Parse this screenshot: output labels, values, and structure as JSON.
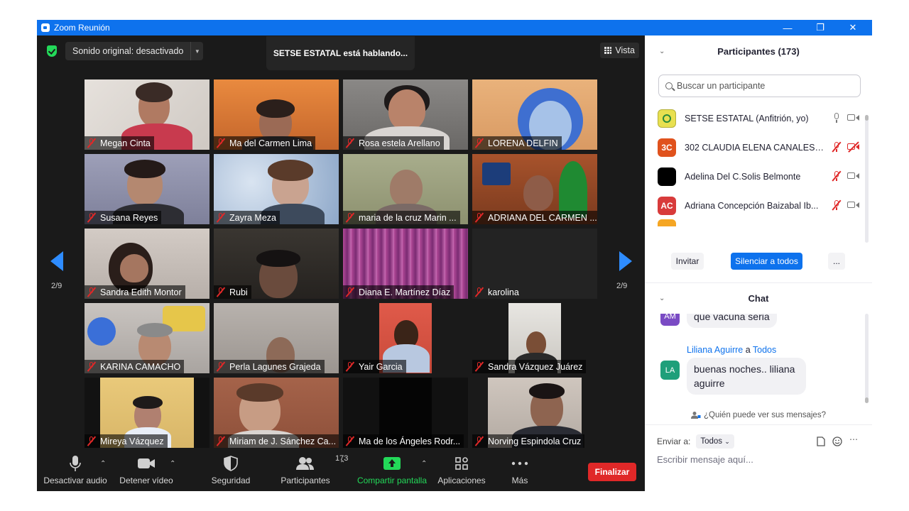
{
  "window": {
    "title": "Zoom Reunión"
  },
  "stage": {
    "sound_label": "Sonido original: desactivado",
    "speaking": "SETSE ESTATAL está hablando...",
    "view_label": "Vista",
    "page_left": "2/9",
    "page_right": "2/9"
  },
  "tiles": [
    {
      "name": "Megan Cinta"
    },
    {
      "name": "Ma del Carmen Lima"
    },
    {
      "name": "Rosa estela Arellano"
    },
    {
      "name": "LORENA DELFIN"
    },
    {
      "name": "Susana Reyes"
    },
    {
      "name": "Zayra Meza"
    },
    {
      "name": "maria de la cruz Marin ..."
    },
    {
      "name": "ADRIANA DEL CARMEN ..."
    },
    {
      "name": "Sandra Edith Montor"
    },
    {
      "name": "Rubi"
    },
    {
      "name": "Diana E. Martínez Díaz"
    },
    {
      "name": "karolina"
    },
    {
      "name": "KARINA CAMACHO"
    },
    {
      "name": "Perla Lagunes  Grajeda"
    },
    {
      "name": "Yair Garcia"
    },
    {
      "name": "Sandra Vázquez Juárez"
    },
    {
      "name": "Mireya Vázquez"
    },
    {
      "name": "Miriam de J. Sánchez Ca..."
    },
    {
      "name": "Ma de los Ángeles Rodr..."
    },
    {
      "name": "Norving Espindola Cruz"
    }
  ],
  "toolbar": {
    "mute_audio": "Desactivar audio",
    "stop_video": "Detener vídeo",
    "security": "Seguridad",
    "participants": "Participantes",
    "participants_count": "173",
    "share_screen": "Compartir pantalla",
    "apps": "Aplicaciones",
    "more": "Más",
    "end": "Finalizar"
  },
  "participants_panel": {
    "title": "Participantes (173)",
    "search_placeholder": "Buscar un participante",
    "list": [
      {
        "name": "SETSE ESTATAL (Anfitrión, yo)",
        "initials": "",
        "color": "#e8e050"
      },
      {
        "name": "302 CLAUDIA ELENA CANALES ...",
        "initials": "3C",
        "color": "#e0521d"
      },
      {
        "name": "Adelina Del C.Solis Belmonte",
        "initials": "",
        "color": "#000000"
      },
      {
        "name": "Adriana Concepción Baizabal Ib...",
        "initials": "AC",
        "color": "#d83b3b"
      }
    ],
    "invite": "Invitar",
    "mute_all": "Silenciar a todos",
    "more": "..."
  },
  "chat_panel": {
    "title": "Chat",
    "messages": [
      {
        "initials": "AM",
        "avatar_color": "#7a4bc4",
        "text": "que vacuna seria"
      },
      {
        "sender": "Liliana Aguirre",
        "to_word": "a",
        "recipient": "Todos",
        "initials": "LA",
        "avatar_color": "#1e9f7a",
        "text_line1": "buenas noches.. liliana",
        "text_line2": "aguirre"
      }
    ],
    "who_can_see": "¿Quién puede ver sus mensajes?",
    "send_to_label": "Enviar a:",
    "send_to_value": "Todos",
    "input_placeholder": "Escribir mensaje aquí..."
  }
}
